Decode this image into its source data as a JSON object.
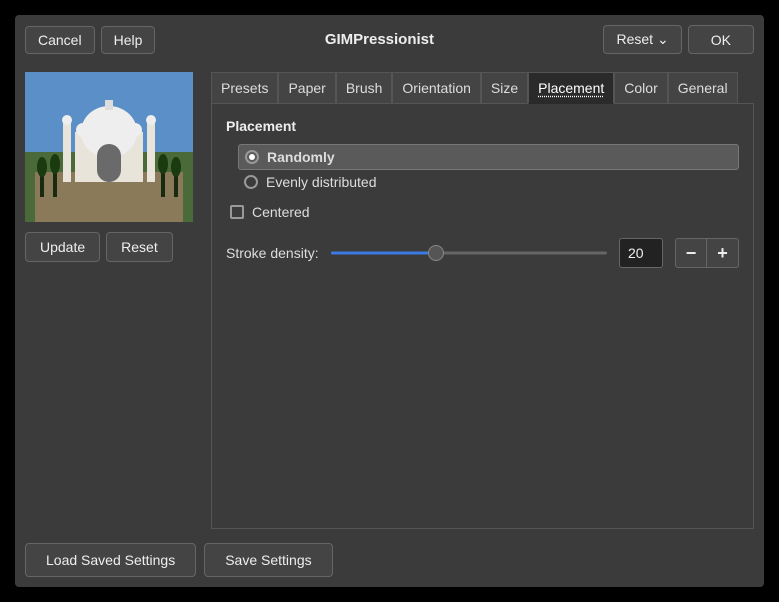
{
  "title": "GIMPressionist",
  "buttons": {
    "cancel": "Cancel",
    "help": "Help",
    "reset": "Reset",
    "ok": "OK",
    "update": "Update",
    "preview_reset": "Reset",
    "load": "Load Saved Settings",
    "save": "Save Settings",
    "minus": "−",
    "plus": "+"
  },
  "tabs": [
    "Presets",
    "Paper",
    "Brush",
    "Orientation",
    "Size",
    "Placement",
    "Color",
    "General"
  ],
  "active_tab": "Placement",
  "placement": {
    "heading": "Placement",
    "option_random": "Randomly",
    "option_even": "Evenly distributed",
    "centered": "Centered"
  },
  "stroke_density": {
    "label": "Stroke density:",
    "value": "20",
    "percent": 38
  }
}
